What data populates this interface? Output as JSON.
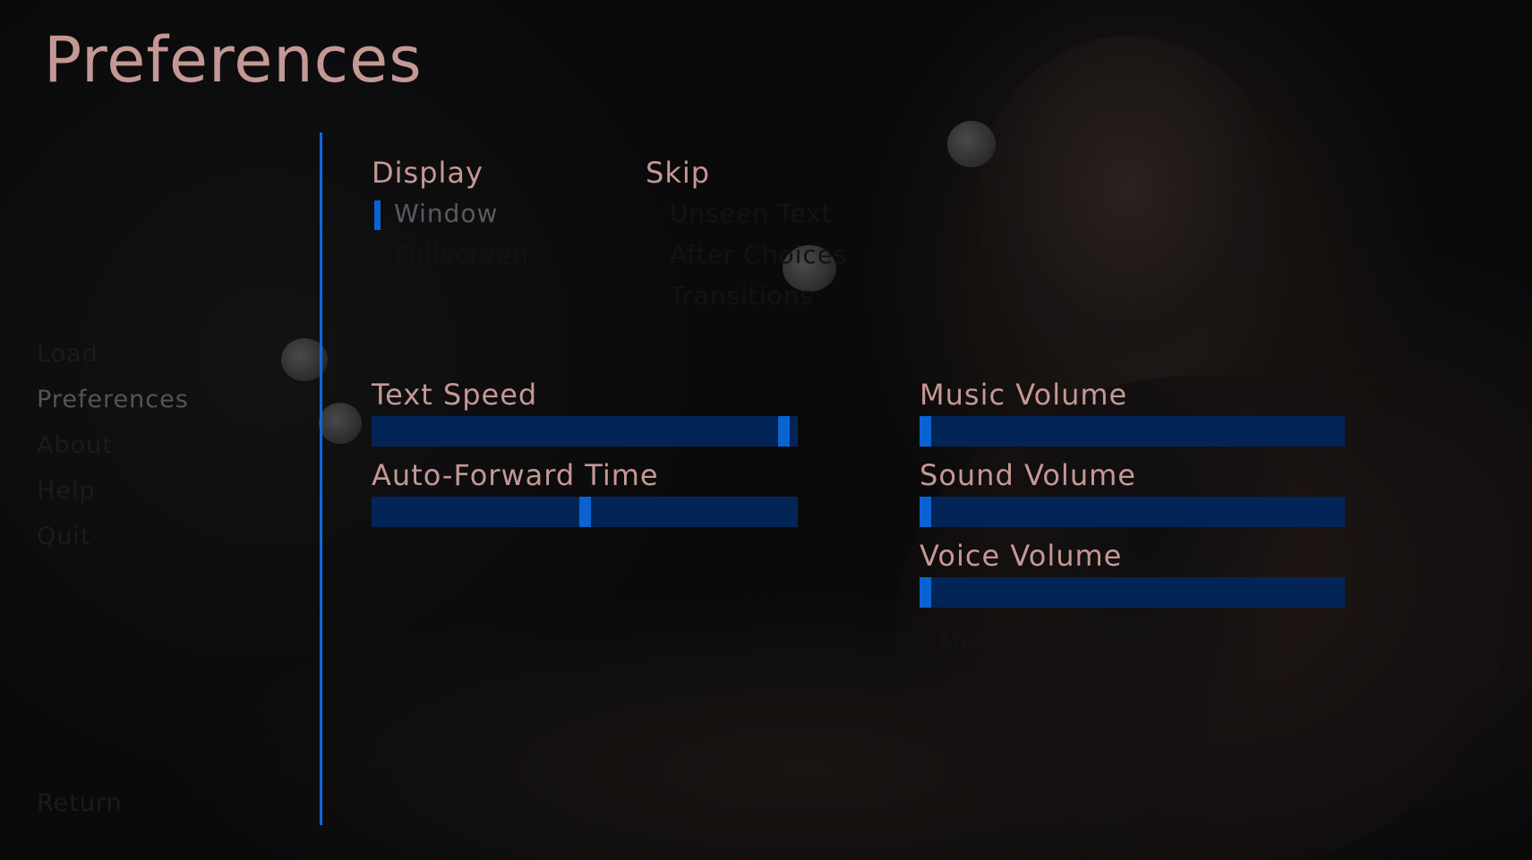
{
  "title": "Preferences",
  "nav": {
    "items": [
      {
        "label": "Load",
        "state": "insensitive"
      },
      {
        "label": "Preferences",
        "state": "selected"
      },
      {
        "label": "About",
        "state": "insensitive"
      },
      {
        "label": "Help",
        "state": "insensitive"
      },
      {
        "label": "Quit",
        "state": "insensitive"
      }
    ],
    "return_label": "Return"
  },
  "display": {
    "header": "Display",
    "options": [
      {
        "label": "Window",
        "selected": true
      },
      {
        "label": "Fullscreen",
        "selected": false
      }
    ]
  },
  "skip": {
    "header": "Skip",
    "options": [
      {
        "label": "Unseen Text",
        "selected": false
      },
      {
        "label": "After Choices",
        "selected": false
      },
      {
        "label": "Transitions",
        "selected": false
      }
    ]
  },
  "sliders": {
    "text_speed": {
      "label": "Text Speed",
      "value": 0.98
    },
    "auto_forward": {
      "label": "Auto-Forward Time",
      "value": 0.5
    },
    "music_volume": {
      "label": "Music Volume",
      "value": 0.0
    },
    "sound_volume": {
      "label": "Sound Volume",
      "value": 0.0
    },
    "voice_volume": {
      "label": "Voice Volume",
      "value": 0.0
    }
  },
  "mute_all": {
    "label": "Mute All",
    "selected": false
  },
  "colors": {
    "accent": "#0a63d1",
    "track": "#032457",
    "label": "#c59895"
  }
}
